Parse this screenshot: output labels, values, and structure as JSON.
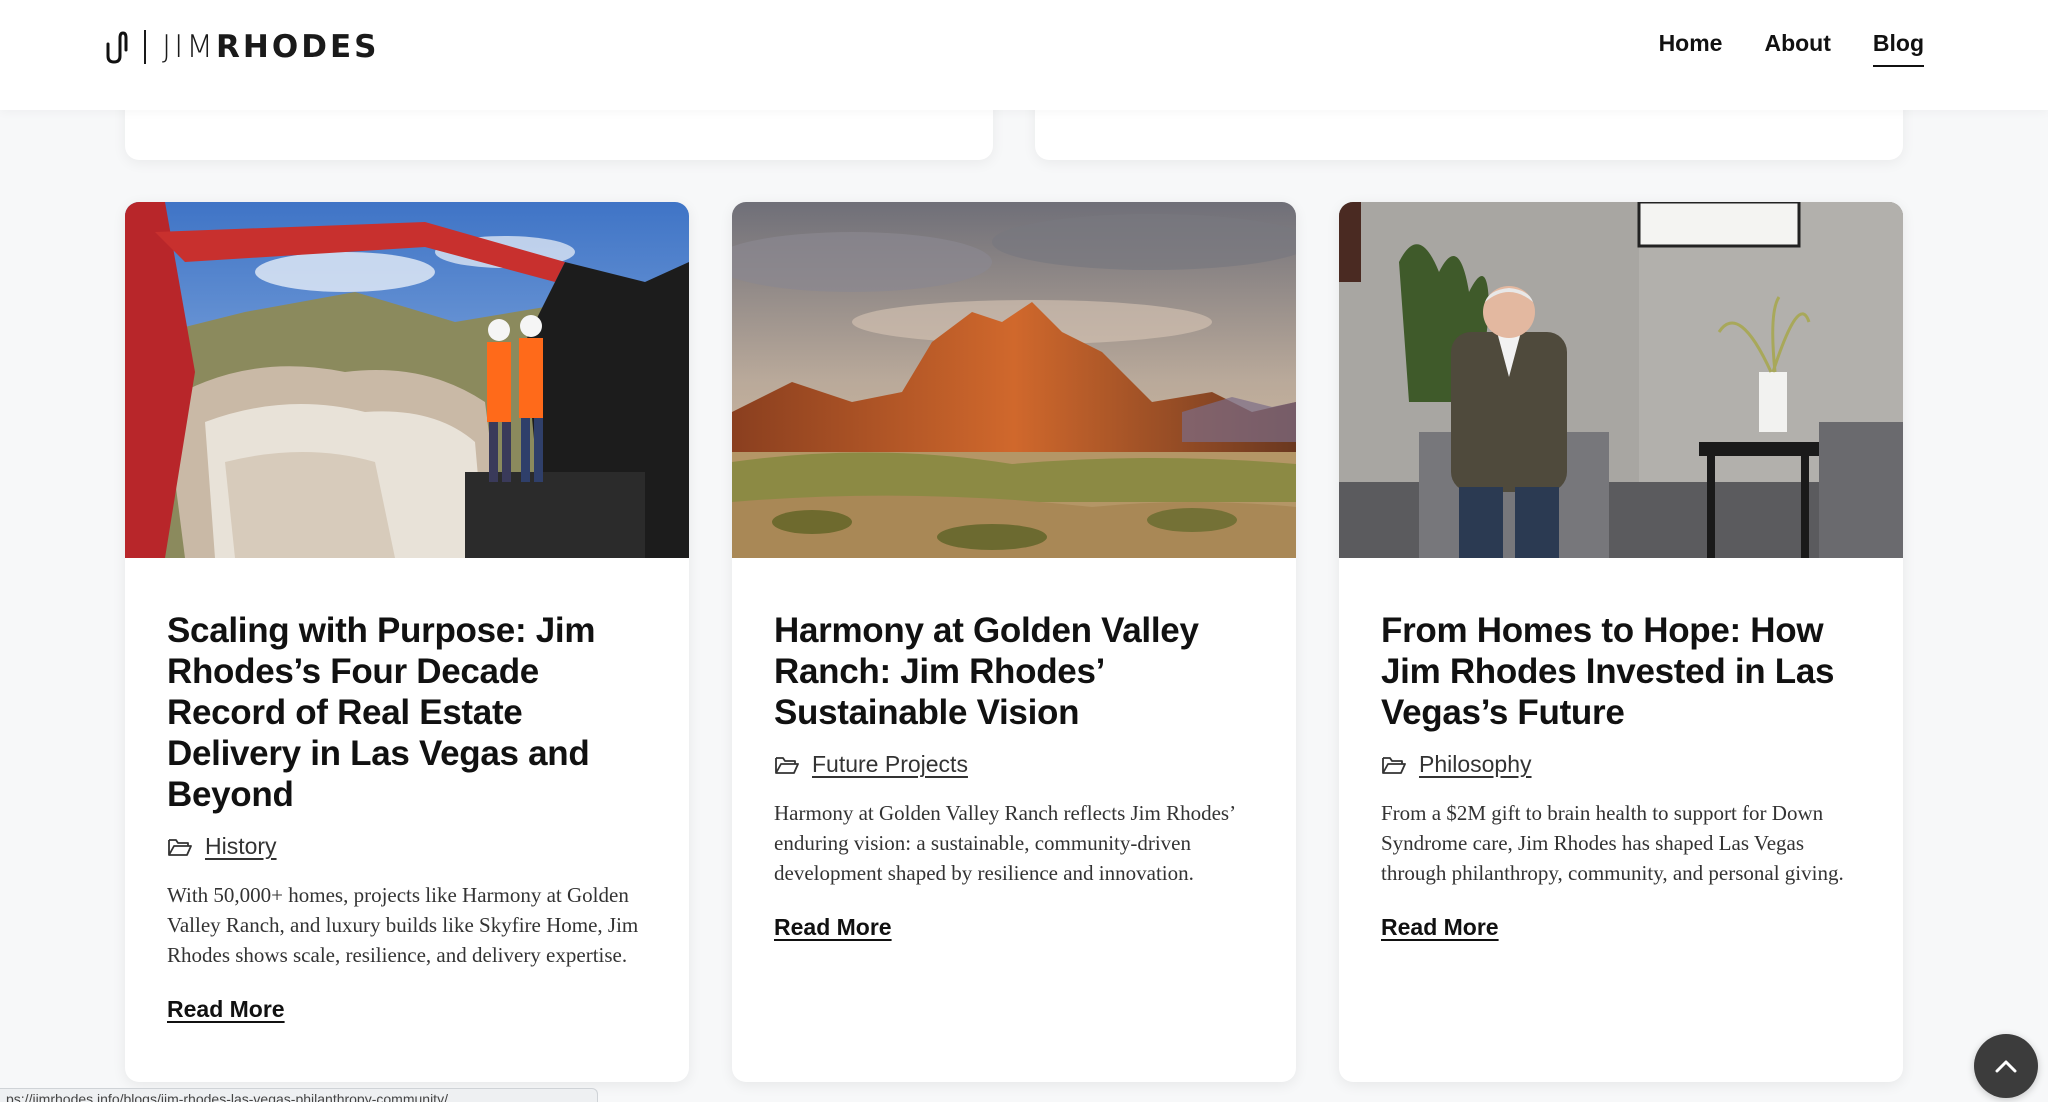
{
  "header": {
    "logo_first": "JIM",
    "logo_last": "RHODES",
    "nav": [
      {
        "label": "Home"
      },
      {
        "label": "About"
      },
      {
        "label": "Blog"
      }
    ]
  },
  "posts": [
    {
      "title": "Scaling with Purpose: Jim Rhodes’s Four Decade Record of Real Estate Delivery in Las Vegas and Beyond",
      "category": "History",
      "excerpt": "With 50,000+ homes, projects like Harmony at Golden Valley Ranch, and luxury builds like Skyfire Home, Jim Rhodes shows scale, resilience, and delivery expertise.",
      "read_more": "Read More"
    },
    {
      "title": "Harmony at Golden Valley Ranch: Jim Rhodes’ Sustainable Vision",
      "category": "Future Projects",
      "excerpt": "Harmony at Golden Valley Ranch reflects Jim Rhodes’ enduring vision: a sustainable, community-driven development shaped by resilience and innovation.",
      "read_more": "Read More"
    },
    {
      "title": "From Homes to Hope: How Jim Rhodes Invested in Las Vegas’s Future",
      "category": "Philosophy",
      "excerpt": "From a $2M gift to brain health to support for Down Syndrome care, Jim Rhodes has shaped Las Vegas through philanthropy, community, and personal giving.",
      "read_more": "Read More"
    }
  ],
  "status_url": "ps://jimrhodes.info/blogs/jim-rhodes-las-vegas-philanthropy-community/"
}
